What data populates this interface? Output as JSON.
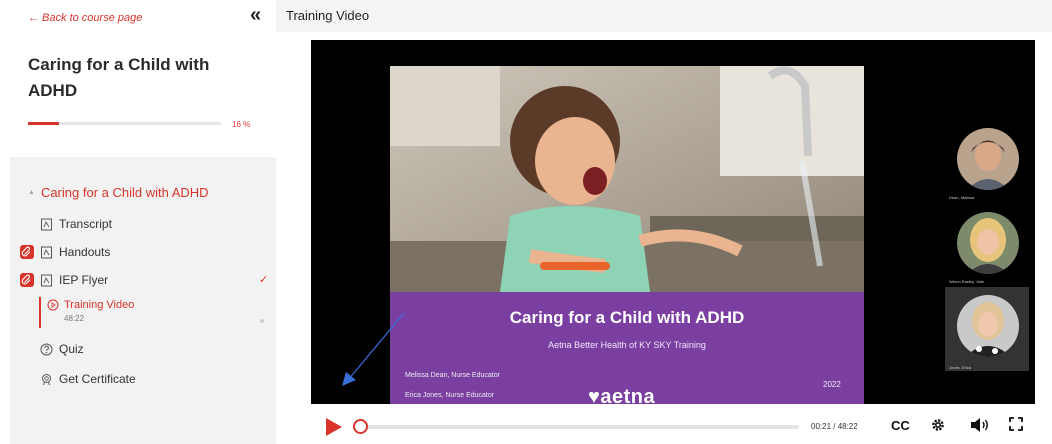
{
  "sidebar": {
    "back_label": "← Back to course page",
    "collapse_glyph": "«",
    "course_title": "Caring for a Child with ADHD",
    "progress": {
      "percent_label": "16 %",
      "value": 0.16
    },
    "module_title": "Caring for a Child with ADHD",
    "items": [
      {
        "label": "Transcript"
      },
      {
        "label": "Handouts"
      },
      {
        "label": "IEP Flyer"
      },
      {
        "label": "Training Video",
        "duration": "48:22"
      },
      {
        "label": "Quiz"
      },
      {
        "label": "Get Certificate"
      }
    ],
    "check_glyph": "✓"
  },
  "header": {
    "title": "Training Video"
  },
  "slide": {
    "title": "Caring for a Child with ADHD",
    "subtitle": "Aetna Better Health of KY SKY Training",
    "presenter_1": "Melissa Dean, Nurse Educator",
    "presenter_2": "Erica Jones, Nurse Educator",
    "year": "2022",
    "brand": "♥aetna"
  },
  "participants": [
    {
      "name": "Dean, Melissa"
    },
    {
      "name": "Wernn Easley, Julie"
    },
    {
      "name": "Jones, Erica"
    }
  ],
  "player": {
    "time_label": "00:21 / 48:22",
    "position_fraction": 0.007,
    "cc_label": "CC"
  },
  "colors": {
    "accent": "#d9342b",
    "slide_purple": "#7a3fa1"
  }
}
